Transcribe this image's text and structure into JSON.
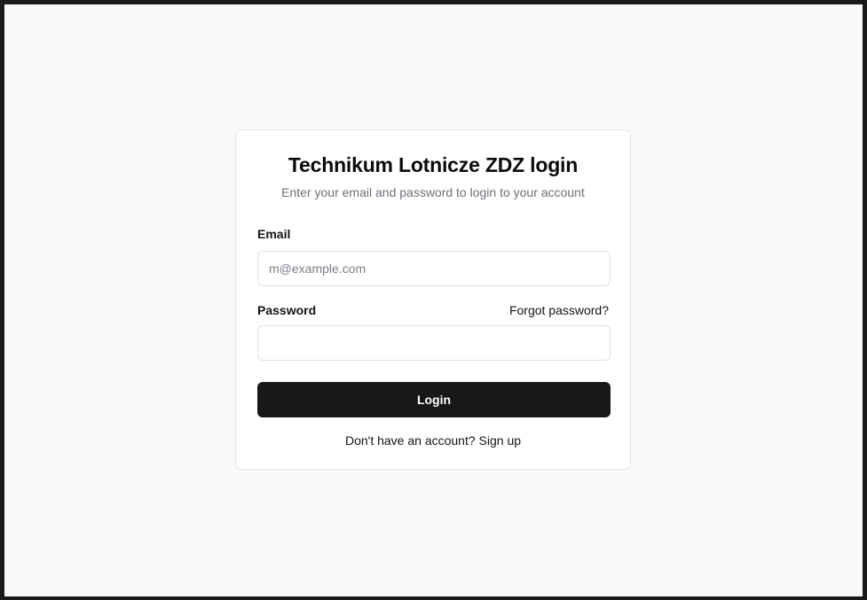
{
  "login": {
    "title": "Technikum Lotnicze ZDZ login",
    "subtitle": "Enter your email and password to login to your account",
    "email_label": "Email",
    "email_placeholder": "m@example.com",
    "email_value": "",
    "password_label": "Password",
    "forgot_password": "Forgot password?",
    "password_value": "",
    "login_button": "Login",
    "signup_prompt": "Don't have an account?",
    "signup_link": "Sign up"
  }
}
